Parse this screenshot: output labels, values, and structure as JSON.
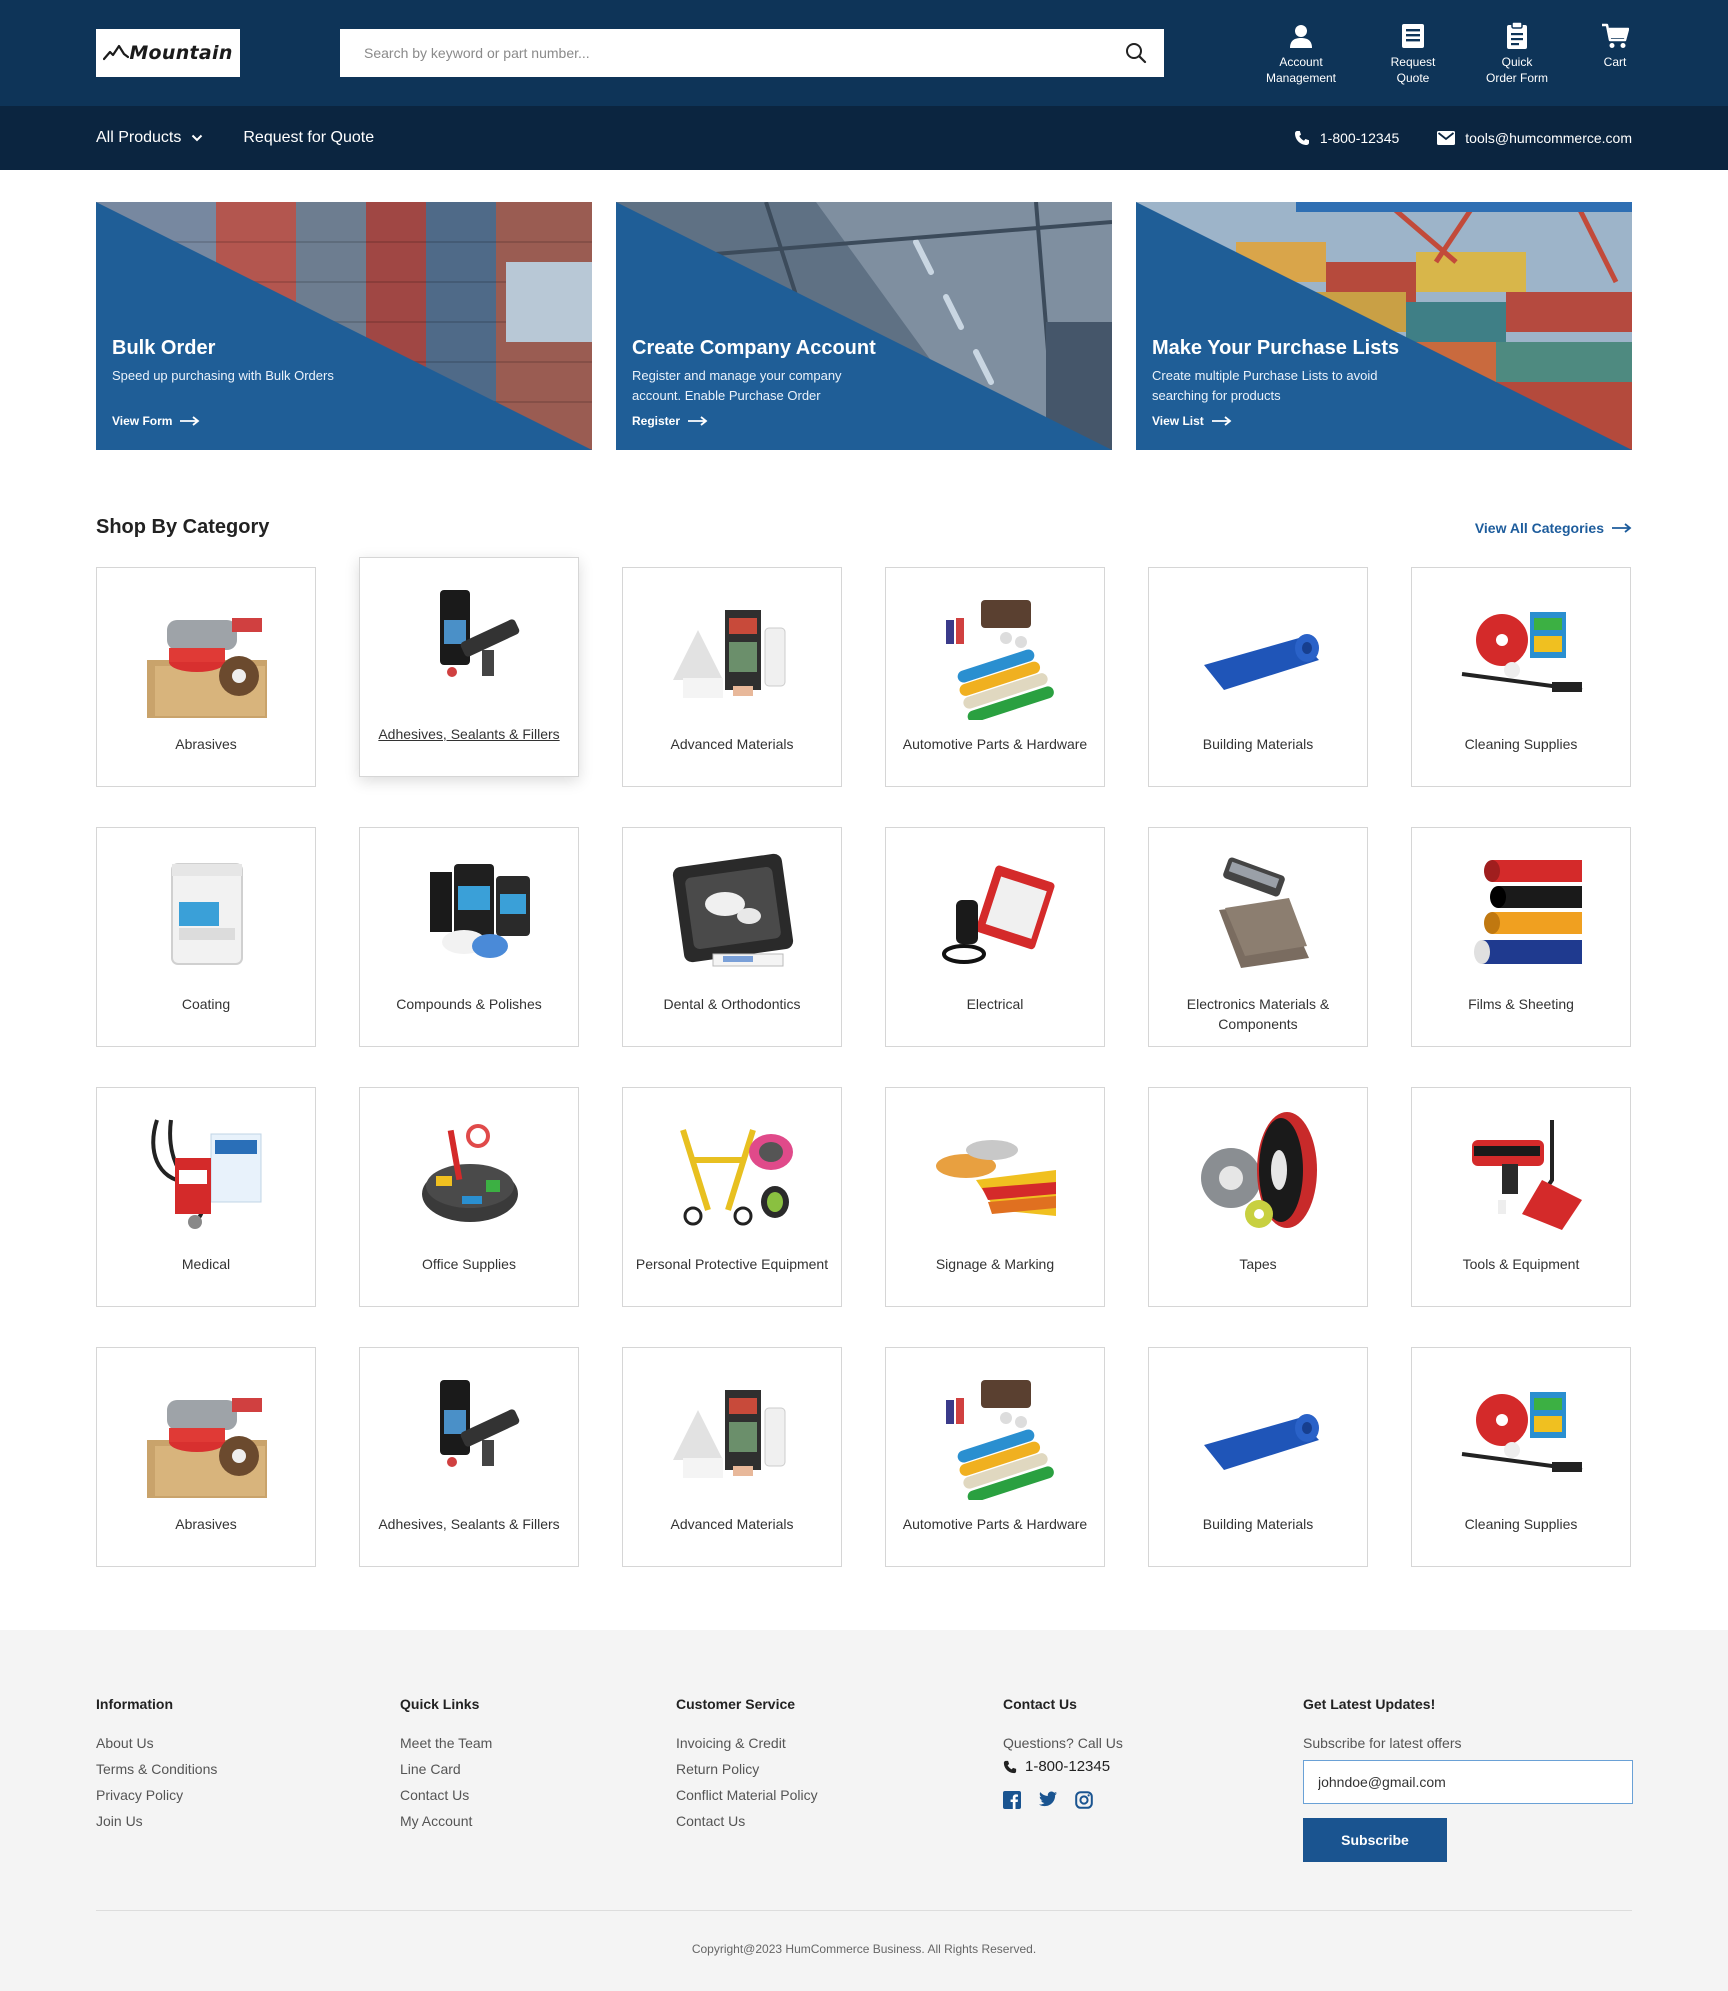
{
  "header": {
    "logo_text": "Mountain",
    "search_placeholder": "Search by keyword or part number...",
    "actions": [
      {
        "label": "Account\nManagement",
        "icon": "user-icon"
      },
      {
        "label": "Request\nQuote",
        "icon": "document-list-icon"
      },
      {
        "label": "Quick\nOrder Form",
        "icon": "clipboard-icon"
      },
      {
        "label": "Cart",
        "icon": "cart-icon"
      }
    ]
  },
  "nav": {
    "all_products": "All Products",
    "request_quote": "Request for Quote",
    "phone": "1-800-12345",
    "email": "tools@humcommerce.com"
  },
  "promos": [
    {
      "title": "Bulk Order",
      "desc": "Speed up purchasing with Bulk Orders",
      "link": "View Form"
    },
    {
      "title": "Create Company Account",
      "desc": "Register and manage your company account. Enable Purchase Order",
      "link": "Register"
    },
    {
      "title": "Make Your Purchase Lists",
      "desc": "Create multiple Purchase Lists to avoid searching for products",
      "link": "View List"
    }
  ],
  "categories_section": {
    "title": "Shop By Category",
    "view_all": "View All Categories"
  },
  "categories": [
    "Abrasives",
    "Adhesives, Sealants & Fillers",
    "Advanced Materials",
    "Automotive Parts & Hardware",
    "Building Materials",
    "Cleaning Supplies",
    "Coating",
    "Compounds & Polishes",
    "Dental & Orthodontics",
    "Electrical",
    "Electronics Materials & Components",
    "Films & Sheeting",
    "Medical",
    "Office Supplies",
    "Personal Protective Equipment",
    "Signage & Marking",
    "Tapes",
    "Tools & Equipment",
    "Abrasives",
    "Adhesives, Sealants & Fillers",
    "Advanced Materials",
    "Automotive Parts & Hardware",
    "Building Materials",
    "Cleaning Supplies"
  ],
  "footer": {
    "information": {
      "title": "Information",
      "links": [
        "About Us",
        "Terms & Conditions",
        "Privacy Policy",
        "Join Us"
      ]
    },
    "quick_links": {
      "title": "Quick Links",
      "links": [
        "Meet the Team",
        "Line Card",
        "Contact Us",
        "My Account"
      ]
    },
    "customer_service": {
      "title": "Customer Service",
      "links": [
        "Invoicing & Credit",
        "Return Policy",
        "Conflict Material Policy",
        "Contact Us"
      ]
    },
    "contact": {
      "title": "Contact Us",
      "question": "Questions? Call Us",
      "phone": "1-800-12345",
      "socials": [
        "facebook-icon",
        "twitter-icon",
        "instagram-icon"
      ]
    },
    "updates": {
      "title": "Get Latest Updates!",
      "subtitle": "Subscribe for latest offers",
      "email_value": "johndoe@gmail.com",
      "button": "Subscribe"
    },
    "copyright": "Copyright@2023 HumCommerce Business. All Rights Reserved."
  },
  "colors": {
    "header_bg": "#0e3458",
    "nav_bg": "#0b2540",
    "promo_blue": "#1f5e97",
    "accent": "#1d5c9c",
    "footer_bg": "#f4f4f4"
  }
}
